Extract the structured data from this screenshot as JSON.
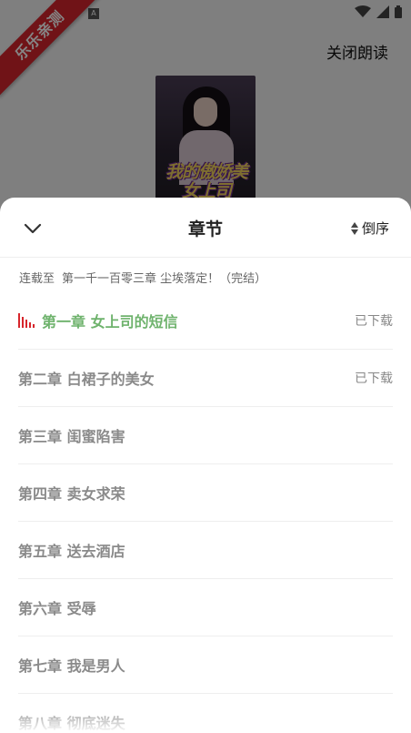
{
  "watermark": {
    "text": "乐乐亲测",
    "color": "#d7262c"
  },
  "status_bar": {
    "notification_letter": "A",
    "icons": [
      "wifi-icon",
      "signal-icon",
      "battery-icon"
    ]
  },
  "header": {
    "close_reading_label": "关闭朗读"
  },
  "cover": {
    "title_art": "我的傲娇美女上司"
  },
  "sheet": {
    "title": "章节",
    "sort_label": "倒序",
    "serial_prefix": "连载至",
    "serial_latest": "第一千一百零三章 尘埃落定！（完结）"
  },
  "chapters": [
    {
      "title": "第一章 女上司的短信",
      "status": "已下载",
      "current": true
    },
    {
      "title": "第二章 白裙子的美女",
      "status": "已下载",
      "current": false
    },
    {
      "title": "第三章 闺蜜陷害",
      "status": "",
      "current": false
    },
    {
      "title": "第四章 卖女求荣",
      "status": "",
      "current": false
    },
    {
      "title": "第五章 送去酒店",
      "status": "",
      "current": false
    },
    {
      "title": "第六章 受辱",
      "status": "",
      "current": false
    },
    {
      "title": "第七章 我是男人",
      "status": "",
      "current": false
    },
    {
      "title": "第八章 彻底迷失",
      "status": "",
      "current": false
    }
  ],
  "colors": {
    "accent_green": "#6fb36d",
    "accent_red": "#d7262c"
  }
}
